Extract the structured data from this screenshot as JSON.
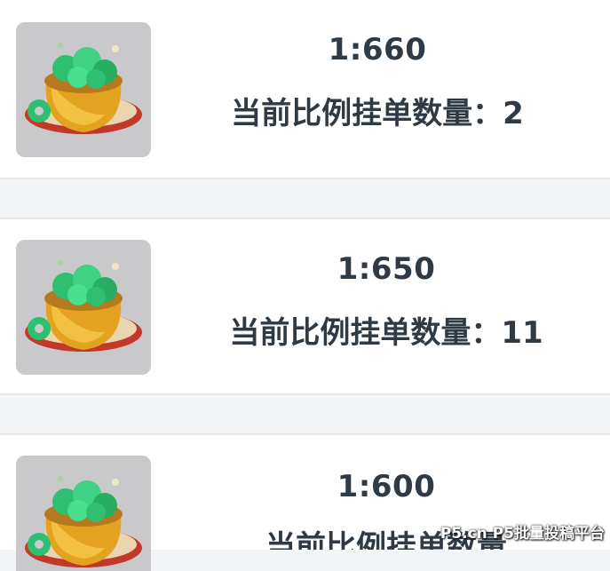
{
  "listings": [
    {
      "rate": "1:660",
      "count_label": "当前比例挂单数量：2",
      "icon": "jade-treasure-pot-icon"
    },
    {
      "rate": "1:650",
      "count_label": "当前比例挂单数量：11",
      "icon": "jade-treasure-pot-icon"
    },
    {
      "rate": "1:600",
      "count_label": "当前比例挂单数量",
      "icon": "jade-treasure-pot-icon"
    }
  ],
  "watermark": "P5.cn P5批量投稿平台",
  "colors": {
    "text": "#2f3a45",
    "card_bg": "#ffffff",
    "page_bg": "#f3f4f6",
    "thumb_bg": "#c9c9cb",
    "pot_gold": "#e3a21f",
    "jade_green": "#2fbf71",
    "cushion_red": "#c0392b"
  }
}
